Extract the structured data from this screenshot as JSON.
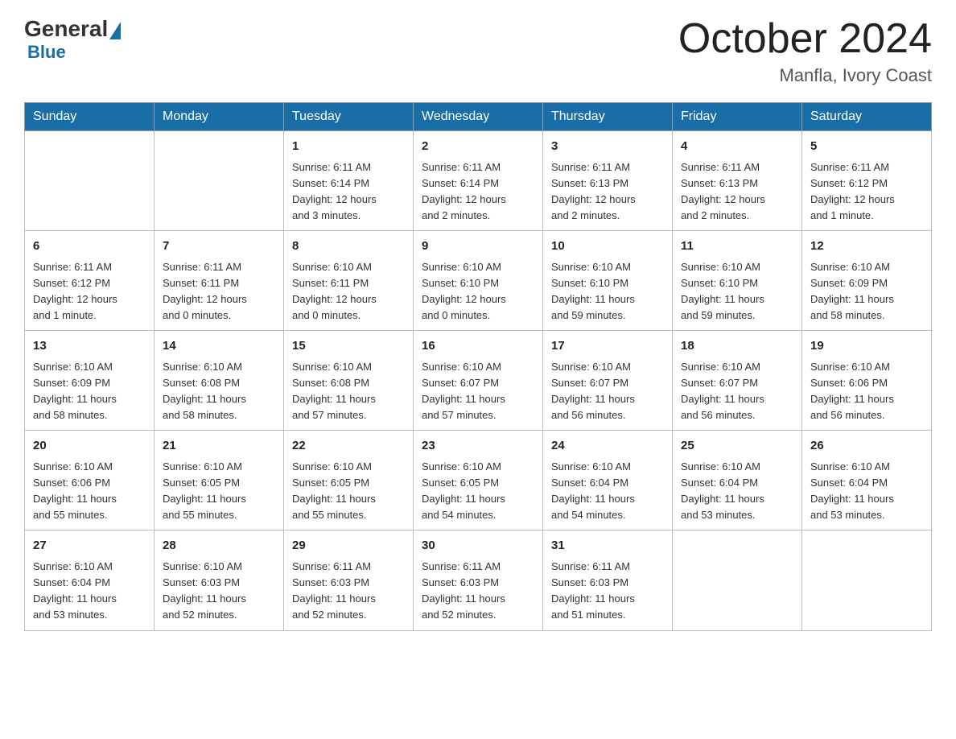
{
  "logo": {
    "text_general": "General",
    "text_blue": "Blue"
  },
  "title": {
    "month": "October 2024",
    "location": "Manfla, Ivory Coast"
  },
  "days_of_week": [
    "Sunday",
    "Monday",
    "Tuesday",
    "Wednesday",
    "Thursday",
    "Friday",
    "Saturday"
  ],
  "weeks": [
    [
      {
        "day": "",
        "info": ""
      },
      {
        "day": "",
        "info": ""
      },
      {
        "day": "1",
        "info": "Sunrise: 6:11 AM\nSunset: 6:14 PM\nDaylight: 12 hours\nand 3 minutes."
      },
      {
        "day": "2",
        "info": "Sunrise: 6:11 AM\nSunset: 6:14 PM\nDaylight: 12 hours\nand 2 minutes."
      },
      {
        "day": "3",
        "info": "Sunrise: 6:11 AM\nSunset: 6:13 PM\nDaylight: 12 hours\nand 2 minutes."
      },
      {
        "day": "4",
        "info": "Sunrise: 6:11 AM\nSunset: 6:13 PM\nDaylight: 12 hours\nand 2 minutes."
      },
      {
        "day": "5",
        "info": "Sunrise: 6:11 AM\nSunset: 6:12 PM\nDaylight: 12 hours\nand 1 minute."
      }
    ],
    [
      {
        "day": "6",
        "info": "Sunrise: 6:11 AM\nSunset: 6:12 PM\nDaylight: 12 hours\nand 1 minute."
      },
      {
        "day": "7",
        "info": "Sunrise: 6:11 AM\nSunset: 6:11 PM\nDaylight: 12 hours\nand 0 minutes."
      },
      {
        "day": "8",
        "info": "Sunrise: 6:10 AM\nSunset: 6:11 PM\nDaylight: 12 hours\nand 0 minutes."
      },
      {
        "day": "9",
        "info": "Sunrise: 6:10 AM\nSunset: 6:10 PM\nDaylight: 12 hours\nand 0 minutes."
      },
      {
        "day": "10",
        "info": "Sunrise: 6:10 AM\nSunset: 6:10 PM\nDaylight: 11 hours\nand 59 minutes."
      },
      {
        "day": "11",
        "info": "Sunrise: 6:10 AM\nSunset: 6:10 PM\nDaylight: 11 hours\nand 59 minutes."
      },
      {
        "day": "12",
        "info": "Sunrise: 6:10 AM\nSunset: 6:09 PM\nDaylight: 11 hours\nand 58 minutes."
      }
    ],
    [
      {
        "day": "13",
        "info": "Sunrise: 6:10 AM\nSunset: 6:09 PM\nDaylight: 11 hours\nand 58 minutes."
      },
      {
        "day": "14",
        "info": "Sunrise: 6:10 AM\nSunset: 6:08 PM\nDaylight: 11 hours\nand 58 minutes."
      },
      {
        "day": "15",
        "info": "Sunrise: 6:10 AM\nSunset: 6:08 PM\nDaylight: 11 hours\nand 57 minutes."
      },
      {
        "day": "16",
        "info": "Sunrise: 6:10 AM\nSunset: 6:07 PM\nDaylight: 11 hours\nand 57 minutes."
      },
      {
        "day": "17",
        "info": "Sunrise: 6:10 AM\nSunset: 6:07 PM\nDaylight: 11 hours\nand 56 minutes."
      },
      {
        "day": "18",
        "info": "Sunrise: 6:10 AM\nSunset: 6:07 PM\nDaylight: 11 hours\nand 56 minutes."
      },
      {
        "day": "19",
        "info": "Sunrise: 6:10 AM\nSunset: 6:06 PM\nDaylight: 11 hours\nand 56 minutes."
      }
    ],
    [
      {
        "day": "20",
        "info": "Sunrise: 6:10 AM\nSunset: 6:06 PM\nDaylight: 11 hours\nand 55 minutes."
      },
      {
        "day": "21",
        "info": "Sunrise: 6:10 AM\nSunset: 6:05 PM\nDaylight: 11 hours\nand 55 minutes."
      },
      {
        "day": "22",
        "info": "Sunrise: 6:10 AM\nSunset: 6:05 PM\nDaylight: 11 hours\nand 55 minutes."
      },
      {
        "day": "23",
        "info": "Sunrise: 6:10 AM\nSunset: 6:05 PM\nDaylight: 11 hours\nand 54 minutes."
      },
      {
        "day": "24",
        "info": "Sunrise: 6:10 AM\nSunset: 6:04 PM\nDaylight: 11 hours\nand 54 minutes."
      },
      {
        "day": "25",
        "info": "Sunrise: 6:10 AM\nSunset: 6:04 PM\nDaylight: 11 hours\nand 53 minutes."
      },
      {
        "day": "26",
        "info": "Sunrise: 6:10 AM\nSunset: 6:04 PM\nDaylight: 11 hours\nand 53 minutes."
      }
    ],
    [
      {
        "day": "27",
        "info": "Sunrise: 6:10 AM\nSunset: 6:04 PM\nDaylight: 11 hours\nand 53 minutes."
      },
      {
        "day": "28",
        "info": "Sunrise: 6:10 AM\nSunset: 6:03 PM\nDaylight: 11 hours\nand 52 minutes."
      },
      {
        "day": "29",
        "info": "Sunrise: 6:11 AM\nSunset: 6:03 PM\nDaylight: 11 hours\nand 52 minutes."
      },
      {
        "day": "30",
        "info": "Sunrise: 6:11 AM\nSunset: 6:03 PM\nDaylight: 11 hours\nand 52 minutes."
      },
      {
        "day": "31",
        "info": "Sunrise: 6:11 AM\nSunset: 6:03 PM\nDaylight: 11 hours\nand 51 minutes."
      },
      {
        "day": "",
        "info": ""
      },
      {
        "day": "",
        "info": ""
      }
    ]
  ]
}
